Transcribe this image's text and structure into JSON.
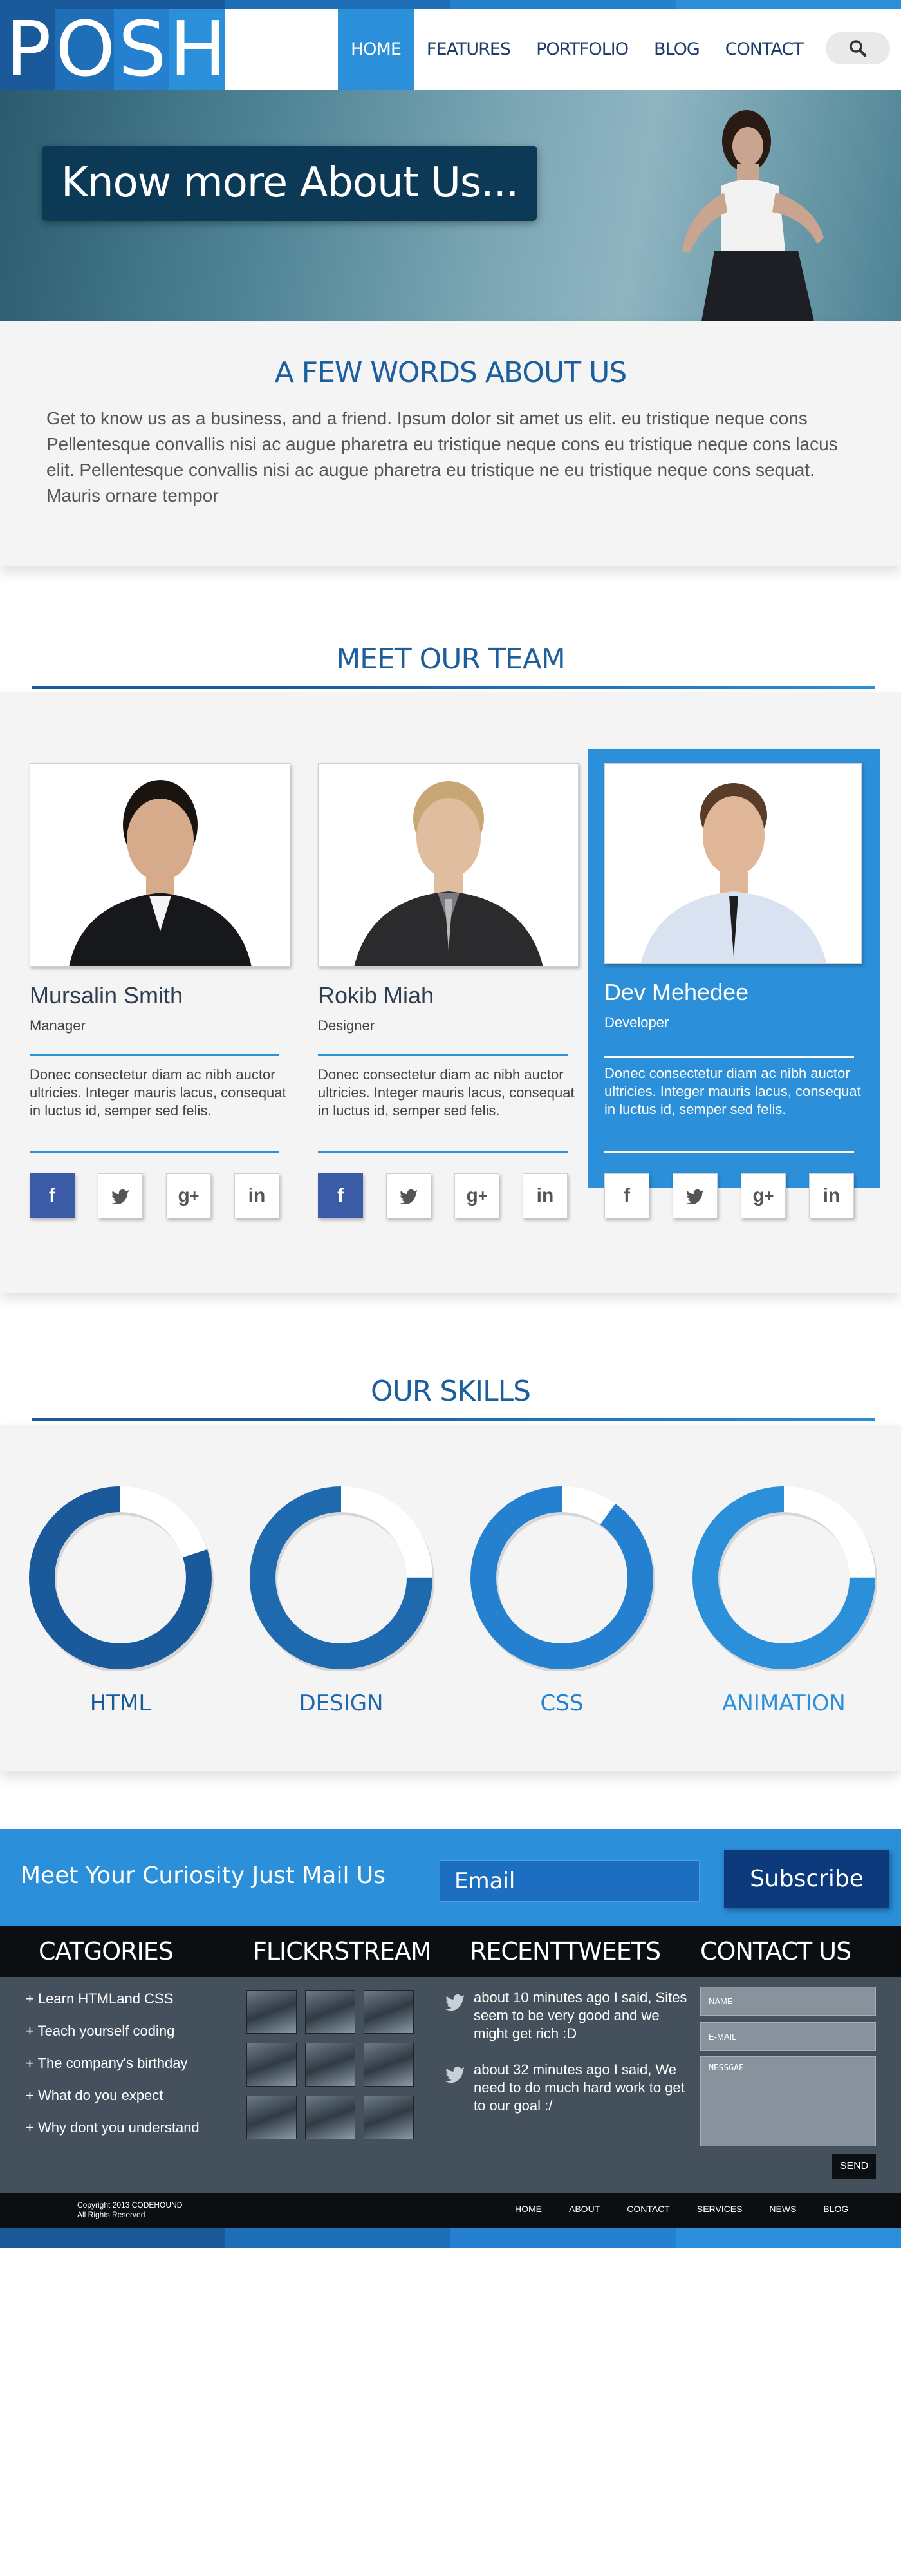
{
  "logo": {
    "letters": [
      "P",
      "O",
      "S",
      "H"
    ],
    "colors": [
      "#1b5a9a",
      "#1f6fb8",
      "#2580cf",
      "#2b8fd9"
    ]
  },
  "nav": {
    "items": [
      "HOME",
      "FEATURES",
      "PORTFOLIO",
      "BLOG",
      "CONTACT"
    ],
    "active": "HOME"
  },
  "hero": {
    "title": "Know more About Us..."
  },
  "about": {
    "title": "A FEW WORDS ABOUT US",
    "text": "Get to know us as a business, and a friend. Ipsum dolor sit amet us elit. eu tristique neque cons Pellentesque convallis  nisi ac augue pharetra eu tristique neque cons eu tristique neque cons lacus elit. Pellentesque convallis nisi ac augue pharetra eu tristique ne eu tristique neque cons sequat. Mauris ornare tempor"
  },
  "team": {
    "title": "MEET OUR TEAM",
    "members": [
      {
        "name": "Mursalin Smith",
        "role": "Manager",
        "desc": "Donec consectetur diam ac nibh auctor ultricies. Integer mauris lacus, consequat in luctus id, semper sed felis.",
        "highlighted": false
      },
      {
        "name": "Rokib Miah",
        "role": "Designer",
        "desc": "Donec consectetur diam ac nibh auctor ultricies. Integer mauris lacus, consequat in luctus id, semper sed felis.",
        "highlighted": false
      },
      {
        "name": "Dev Mehedee",
        "role": "Developer",
        "desc": "Donec consectetur diam ac nibh auctor ultricies. Integer mauris lacus, consequat in luctus id, semper sed felis.",
        "highlighted": true
      }
    ],
    "social": [
      "f",
      "twitter",
      "g+",
      "in"
    ]
  },
  "skills": {
    "title": "OUR SKILLS",
    "items": [
      {
        "label": "HTML",
        "color": "#1b5a9a",
        "fraction": 0.8
      },
      {
        "label": "DESIGN",
        "color": "#1f6aae",
        "fraction": 0.75
      },
      {
        "label": "CSS",
        "color": "#2580cf",
        "fraction": 0.9
      },
      {
        "label": "ANIMATION",
        "color": "#2b8fd9",
        "fraction": 0.75
      }
    ]
  },
  "subscribe": {
    "text": "Meet Your Curiosity Just Mail Us",
    "placeholder": "Email",
    "button": "Subscribe"
  },
  "footer": {
    "categories_title": "CATGORIES",
    "categories": [
      "+ Learn HTMLand CSS",
      "+ Teach yourself coding",
      "+ The company's birthday",
      "+ What do you expect",
      "+ Why dont you understand"
    ],
    "flickr_title": "FLICKRSTREAM",
    "tweets_title": "RECENTTWEETS",
    "tweets": [
      "about 10 minutes ago I said, Sites seem to be very good and we might get rich :D",
      "about 32 minutes ago I said, We need to do much hard work to get to our goal :/"
    ],
    "contact_title": "CONTACT US",
    "contact": {
      "name": "NAME",
      "email": "E-MAIL",
      "message": "MESSGAE",
      "send": "SEND"
    },
    "copyright_1": "Copyright 2013 CODEHOUND",
    "copyright_2": "All Rights Reserved",
    "nav": [
      "HOME",
      "ABOUT",
      "CONTACT",
      "SERVICES",
      "NEWS",
      "BLOG"
    ]
  }
}
